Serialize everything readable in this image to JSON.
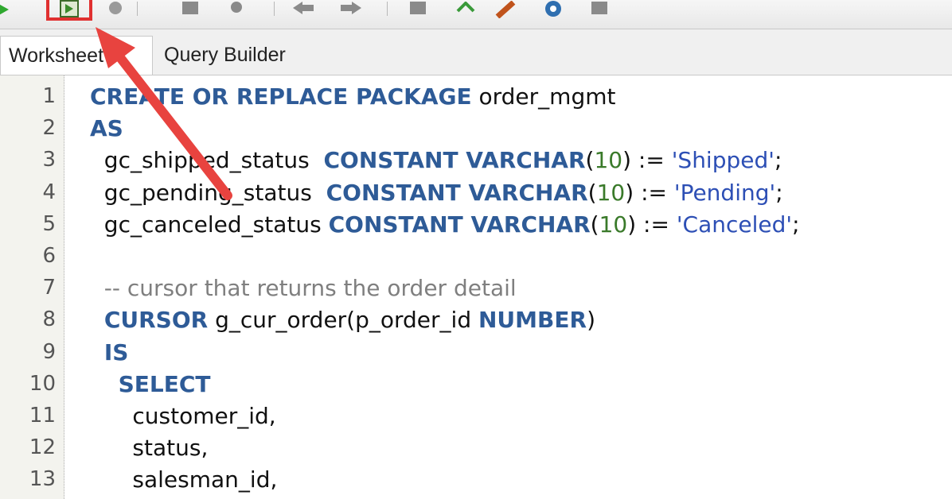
{
  "toolbar": {
    "buttons": [
      {
        "icon": "run-statement-icon",
        "color": "#2fa82f"
      },
      {
        "icon": "run-script-icon",
        "color": "#4a7a2f",
        "highlighted": true
      },
      {
        "icon": "commit-icon",
        "color": "#7a7a7a"
      },
      {
        "icon": "rollback-icon",
        "color": "#7a7a7a"
      },
      {
        "icon": "find-icon",
        "color": "#7a7a7a"
      },
      {
        "icon": "undo-icon",
        "color": "#7a7a7a"
      },
      {
        "icon": "redo-icon",
        "color": "#7a7a7a"
      },
      {
        "icon": "sql-tuning-icon",
        "color": "#7a7a7a"
      },
      {
        "icon": "convert-case-icon",
        "color": "#3a9a3a"
      },
      {
        "icon": "clear-icon",
        "color": "#c0531c"
      },
      {
        "icon": "explain-plan-icon",
        "color": "#2f6fb0"
      },
      {
        "icon": "autotrace-icon",
        "color": "#7a7a7a"
      }
    ]
  },
  "tabs": [
    {
      "label": "Worksheet"
    },
    {
      "label": "Query Builder"
    }
  ],
  "editor": {
    "line_numbers": [
      "1",
      "2",
      "3",
      "4",
      "5",
      "6",
      "7",
      "8",
      "9",
      "10",
      "11",
      "12",
      "13"
    ],
    "lines": [
      [
        {
          "t": "CREATE OR REPLACE PACKAGE",
          "c": "kw"
        },
        {
          "t": " order_mgmt",
          "c": ""
        }
      ],
      [
        {
          "t": "AS",
          "c": "kw"
        }
      ],
      [
        {
          "t": "  gc_shipped_status  ",
          "c": ""
        },
        {
          "t": "CONSTANT VARCHAR",
          "c": "kw"
        },
        {
          "t": "(",
          "c": ""
        },
        {
          "t": "10",
          "c": "num"
        },
        {
          "t": ") := ",
          "c": ""
        },
        {
          "t": "'Shipped'",
          "c": "str"
        },
        {
          "t": ";",
          "c": ""
        }
      ],
      [
        {
          "t": "  gc_pending_status  ",
          "c": ""
        },
        {
          "t": "CONSTANT VARCHAR",
          "c": "kw"
        },
        {
          "t": "(",
          "c": ""
        },
        {
          "t": "10",
          "c": "num"
        },
        {
          "t": ") := ",
          "c": ""
        },
        {
          "t": "'Pending'",
          "c": "str"
        },
        {
          "t": ";",
          "c": ""
        }
      ],
      [
        {
          "t": "  gc_canceled_status ",
          "c": ""
        },
        {
          "t": "CONSTANT VARCHAR",
          "c": "kw"
        },
        {
          "t": "(",
          "c": ""
        },
        {
          "t": "10",
          "c": "num"
        },
        {
          "t": ") := ",
          "c": ""
        },
        {
          "t": "'Canceled'",
          "c": "str"
        },
        {
          "t": ";",
          "c": ""
        }
      ],
      [],
      [
        {
          "t": "  -- cursor that returns the order detail",
          "c": "cmt"
        }
      ],
      [
        {
          "t": "  ",
          "c": ""
        },
        {
          "t": "CURSOR",
          "c": "kw"
        },
        {
          "t": " g_cur_order(p_order_id ",
          "c": ""
        },
        {
          "t": "NUMBER",
          "c": "kw"
        },
        {
          "t": ")",
          "c": ""
        }
      ],
      [
        {
          "t": "  ",
          "c": ""
        },
        {
          "t": "IS",
          "c": "kw"
        }
      ],
      [
        {
          "t": "    ",
          "c": ""
        },
        {
          "t": "SELECT",
          "c": "kw"
        }
      ],
      [
        {
          "t": "      customer_id,",
          "c": ""
        }
      ],
      [
        {
          "t": "      status,",
          "c": ""
        }
      ],
      [
        {
          "t": "      salesman_id,",
          "c": ""
        }
      ]
    ]
  },
  "annotation": {
    "color": "#e8433f"
  }
}
